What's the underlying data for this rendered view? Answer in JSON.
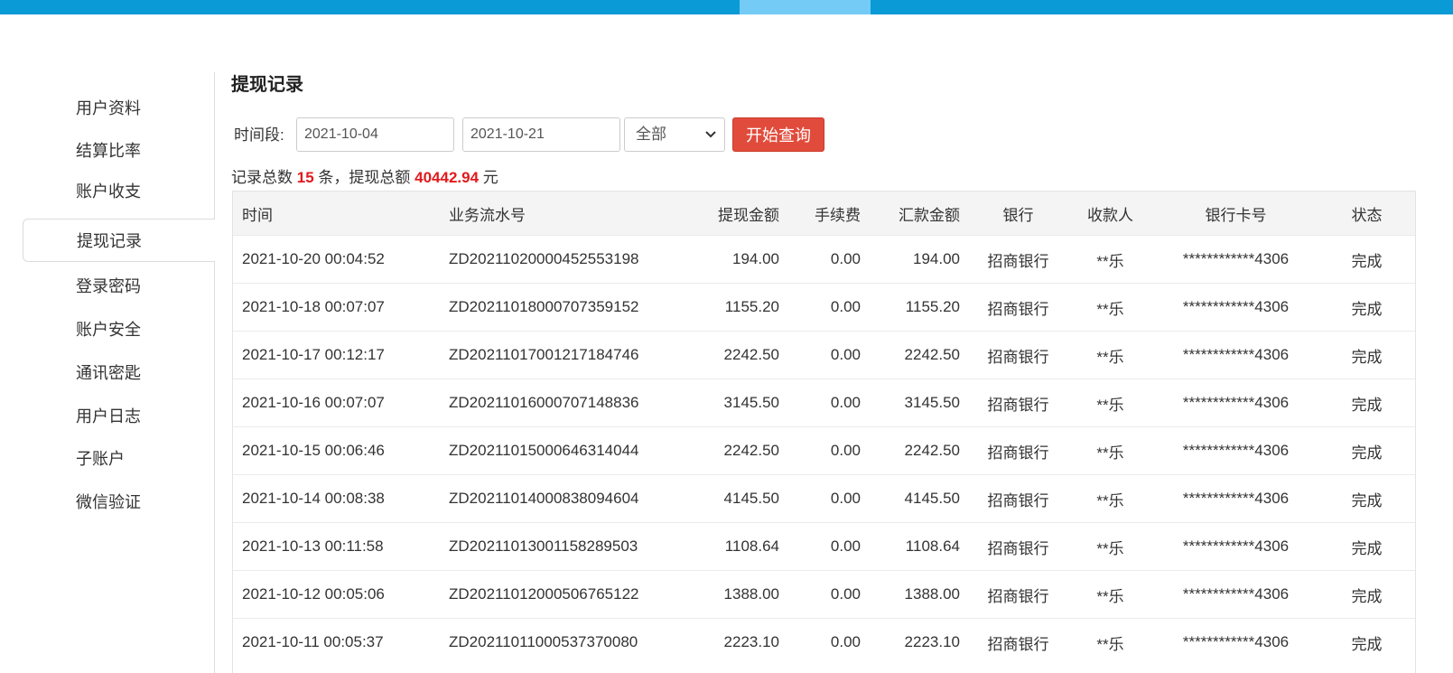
{
  "colors": {
    "top_bar": "#0a9ad6",
    "top_bar_highlight": "#74cbf5",
    "search_button": "#e14b3b",
    "highlight_number": "#e3191c"
  },
  "sidebar": {
    "items": [
      {
        "label": "用户资料"
      },
      {
        "label": "结算比率"
      },
      {
        "label": "账户收支"
      },
      {
        "label": "提现记录",
        "active": true
      },
      {
        "label": "登录密码"
      },
      {
        "label": "账户安全"
      },
      {
        "label": "通讯密匙"
      },
      {
        "label": "用户日志"
      },
      {
        "label": "子账户"
      },
      {
        "label": "微信验证"
      }
    ]
  },
  "main": {
    "title": "提现记录",
    "filter": {
      "label": "时间段:",
      "start_date": "2021-10-04",
      "end_date": "2021-10-21",
      "status_selected": "全部",
      "search_label": "开始查询"
    },
    "summary": {
      "prefix": "记录总数",
      "count": "15",
      "middle": "条，提现总额",
      "total": "40442.94",
      "suffix": "元"
    },
    "table": {
      "headers": [
        "时间",
        "业务流水号",
        "提现金额",
        "手续费",
        "汇款金额",
        "银行",
        "收款人",
        "银行卡号",
        "状态"
      ],
      "rows": [
        [
          "2021-10-20 00:04:52",
          "ZD20211020000452553198",
          "194.00",
          "0.00",
          "194.00",
          "招商银行",
          "**乐",
          "************4306",
          "完成"
        ],
        [
          "2021-10-18 00:07:07",
          "ZD20211018000707359152",
          "1155.20",
          "0.00",
          "1155.20",
          "招商银行",
          "**乐",
          "************4306",
          "完成"
        ],
        [
          "2021-10-17 00:12:17",
          "ZD20211017001217184746",
          "2242.50",
          "0.00",
          "2242.50",
          "招商银行",
          "**乐",
          "************4306",
          "完成"
        ],
        [
          "2021-10-16 00:07:07",
          "ZD20211016000707148836",
          "3145.50",
          "0.00",
          "3145.50",
          "招商银行",
          "**乐",
          "************4306",
          "完成"
        ],
        [
          "2021-10-15 00:06:46",
          "ZD20211015000646314044",
          "2242.50",
          "0.00",
          "2242.50",
          "招商银行",
          "**乐",
          "************4306",
          "完成"
        ],
        [
          "2021-10-14 00:08:38",
          "ZD20211014000838094604",
          "4145.50",
          "0.00",
          "4145.50",
          "招商银行",
          "**乐",
          "************4306",
          "完成"
        ],
        [
          "2021-10-13 00:11:58",
          "ZD20211013001158289503",
          "1108.64",
          "0.00",
          "1108.64",
          "招商银行",
          "**乐",
          "************4306",
          "完成"
        ],
        [
          "2021-10-12 00:05:06",
          "ZD20211012000506765122",
          "1388.00",
          "0.00",
          "1388.00",
          "招商银行",
          "**乐",
          "************4306",
          "完成"
        ],
        [
          "2021-10-11 00:05:37",
          "ZD20211011000537370080",
          "2223.10",
          "0.00",
          "2223.10",
          "招商银行",
          "**乐",
          "************4306",
          "完成"
        ]
      ]
    }
  }
}
